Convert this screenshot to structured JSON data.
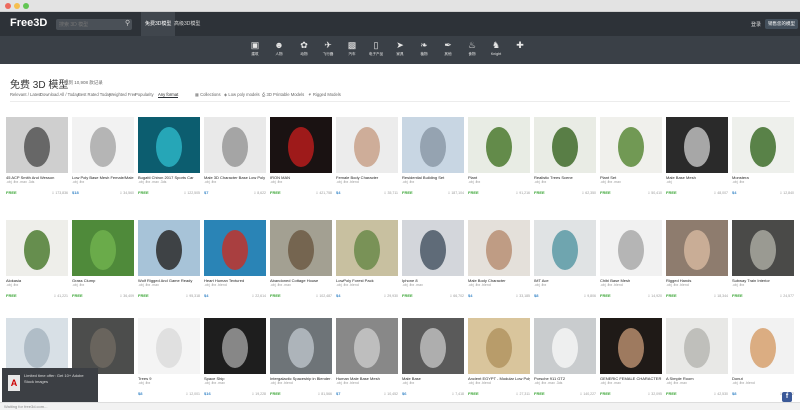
{
  "header": {
    "logo": "Free3D",
    "search_placeholder": "搜索 3D 模型",
    "tabs": [
      {
        "label": "免费3D模型"
      },
      {
        "label": "高级3D模型"
      }
    ],
    "links": [
      {
        "label": "登录"
      }
    ],
    "cta": "销售您的模型"
  },
  "categories": [
    {
      "label": "建筑",
      "icon": "building-icon"
    },
    {
      "label": "人物",
      "icon": "person-icon"
    },
    {
      "label": "动物",
      "icon": "paw-icon"
    },
    {
      "label": "飞行器",
      "icon": "plane-icon"
    },
    {
      "label": "汽车",
      "icon": "car-icon"
    },
    {
      "label": "电子产品",
      "icon": "phone-icon"
    },
    {
      "label": "家具",
      "icon": "sofa-icon"
    },
    {
      "label": "植物",
      "icon": "leaf-icon"
    },
    {
      "label": "其他",
      "icon": "feather-icon"
    },
    {
      "label": "食物",
      "icon": "food-icon"
    },
    {
      "label": "Knight",
      "icon": "knight-icon"
    },
    {
      "label": "",
      "icon": "plus-icon"
    }
  ],
  "page": {
    "title": "免费 3D 模型",
    "count": "找到 10,908 款记录"
  },
  "filters": [
    {
      "label": "Relevant / Latest",
      "active": false
    },
    {
      "label": "Download All / Today",
      "active": false
    },
    {
      "label": "Best Rated Today",
      "active": false
    },
    {
      "label": "Weighted Free",
      "active": false
    },
    {
      "label": "Popularity",
      "active": false
    },
    {
      "label": "Any format",
      "active": true
    }
  ],
  "filter_icons": [
    {
      "label": "Collections"
    },
    {
      "label": "Low poly models"
    },
    {
      "label": "3D Printable Models"
    },
    {
      "label": "Rigged Models"
    }
  ],
  "rows": [
    [
      {
        "title": "45 ACP Smith And Wesson",
        "formats": ".obj .fbx .max .3ds",
        "price": "FREE",
        "stats": "173,836",
        "thumb": "#cfcfcf",
        "fg": "#555"
      },
      {
        "title": "Low Poly Base Mesh Female/Male",
        "formats": ".obj .fbx",
        "price": "$18",
        "stats": "34,560",
        "thumb": "#f2f2f2",
        "fg": "#aaa"
      },
      {
        "title": "Bugatti Chiron 2017 Sports Car",
        "formats": ".obj .fbx .max .3ds",
        "price": "FREE",
        "stats": "122,505",
        "thumb": "#0c5d6f",
        "fg": "#2bb3c4"
      },
      {
        "title": "Male 3D Character Base Low Poly Model",
        "formats": ".obj .fbx",
        "price": "$7",
        "stats": "8,622",
        "thumb": "#e9e9e9",
        "fg": "#999"
      },
      {
        "title": "IRON MAN",
        "formats": ".obj .fbx",
        "price": "FREE",
        "stats": "421,758",
        "thumb": "#1a1212",
        "fg": "#b61c1c"
      },
      {
        "title": "Female Body Character",
        "formats": ".obj .fbx .blend",
        "price": "$4",
        "stats": "35,711",
        "thumb": "#ececec",
        "fg": "#c9a28b"
      },
      {
        "title": "Residential Building Set",
        "formats": ".obj .fbx",
        "price": "FREE",
        "stats": "187,104",
        "thumb": "#c8d6e3",
        "fg": "#8c9aa8"
      },
      {
        "title": "Plant",
        "formats": ".obj .fbx",
        "price": "FREE",
        "stats": "91,216",
        "thumb": "#e8ece4",
        "fg": "#4b7a2f"
      },
      {
        "title": "Realistic Trees Scene",
        "formats": ".obj .fbx",
        "price": "FREE",
        "stats": "62,350",
        "thumb": "#e9ece5",
        "fg": "#3f6b2a"
      },
      {
        "title": "Plant Set",
        "formats": ".obj .fbx .max",
        "price": "FREE",
        "stats": "50,410",
        "thumb": "#f0f0ec",
        "fg": "#5a8a3a"
      },
      {
        "title": "Male Base Mesh",
        "formats": ".obj",
        "price": "FREE",
        "stats": "48,007",
        "thumb": "#2a2a2a",
        "fg": "#bdbdbd"
      },
      {
        "title": "Monstera",
        "formats": ".obj .fbx",
        "price": "$4",
        "stats": "12,840",
        "thumb": "#eef0ec",
        "fg": "#3e6e2c"
      }
    ],
    [
      {
        "title": "Alokasia",
        "formats": ".obj .fbx",
        "price": "FREE",
        "stats": "41,221",
        "thumb": "#eeeeea",
        "fg": "#4d7c33"
      },
      {
        "title": "Grass Clump",
        "formats": ".obj .fbx",
        "price": "FREE",
        "stats": "36,409",
        "thumb": "#4f8a3a",
        "fg": "#6fb04e"
      },
      {
        "title": "Wolf Rigged And Game Ready",
        "formats": ".obj .fbx .max",
        "price": "FREE",
        "stats": "95,318",
        "thumb": "#a7c3d8",
        "fg": "#2b2b2b"
      },
      {
        "title": "Heart Human Textured",
        "formats": ".obj .fbx .blend",
        "price": "$4",
        "stats": "22,614",
        "thumb": "#2a84b6",
        "fg": "#c0322b"
      },
      {
        "title": "Abandoned Cottage House",
        "formats": ".obj .fbx .max",
        "price": "FREE",
        "stats": "102,487",
        "thumb": "#a3a092",
        "fg": "#6d5b44"
      },
      {
        "title": "LowPoly Forest Pack",
        "formats": ".obj .fbx .blend",
        "price": "$4",
        "stats": "29,930",
        "thumb": "#c8c0a0",
        "fg": "#6b8a4a"
      },
      {
        "title": "Iphone 8",
        "formats": ".obj .fbx .max",
        "price": "FREE",
        "stats": "66,702",
        "thumb": "#d3d6db",
        "fg": "#4a5866"
      },
      {
        "title": "Male Body Character",
        "formats": ".obj .fbx .blend",
        "price": "$4",
        "stats": "33,185",
        "thumb": "#e4e0da",
        "fg": "#b98f74"
      },
      {
        "title": "IMT Ace",
        "formats": ".obj .fbx",
        "price": "$8",
        "stats": "9,806",
        "thumb": "#e0e3e4",
        "fg": "#5b9aa6"
      },
      {
        "title": "Chibi Base Mesh",
        "formats": ".obj .fbx .blend",
        "price": "FREE",
        "stats": "14,920",
        "thumb": "#f1f1f1",
        "fg": "#aaaaaa"
      },
      {
        "title": "Rigged Hands",
        "formats": ".obj .fbx .blend",
        "price": "FREE",
        "stats": "18,344",
        "thumb": "#8e7c6e",
        "fg": "#d4b69e"
      },
      {
        "title": "Subway Train Interior",
        "formats": ".obj .fbx",
        "price": "FREE",
        "stats": "24,577",
        "thumb": "#4a4a48",
        "fg": "#a8a8a0"
      }
    ],
    [
      {
        "title": "",
        "formats": "",
        "price": "",
        "stats": "",
        "thumb": "#d8e0e6",
        "fg": "#a9b6c1"
      },
      {
        "title": "",
        "formats": "",
        "price": "",
        "stats": "",
        "thumb": "#4c4d4c",
        "fg": "#6f6860"
      },
      {
        "title": "Trees 9",
        "formats": ".obj .fbx",
        "price": "$8",
        "stats": "12,001",
        "thumb": "#f4f4f4",
        "fg": "#dcdcdc"
      },
      {
        "title": "Space Ship",
        "formats": ".obj .fbx .max",
        "price": "$16",
        "stats": "19,228",
        "thumb": "#1e1e1e",
        "fg": "#9a9a9a"
      },
      {
        "title": "Intergalactic Spaceship in Blender 2.8 Eevee",
        "formats": ".obj .fbx .blend",
        "price": "FREE",
        "stats": "81,566",
        "thumb": "#6e7478",
        "fg": "#b8c0c6"
      },
      {
        "title": "Human Male Base Mesh",
        "formats": ".obj .fbx .blend",
        "price": "$7",
        "stats": "10,452",
        "thumb": "#888888",
        "fg": "#c8c8c8"
      },
      {
        "title": "Male Base",
        "formats": ".obj .fbx",
        "price": "$6",
        "stats": "7,418",
        "thumb": "#5a5a5a",
        "fg": "#bdbdbd"
      },
      {
        "title": "Ancient EGYPT - Modular Low Poly Architecture Set For Games",
        "formats": ".obj .fbx .blend",
        "price": "FREE",
        "stats": "27,311",
        "thumb": "#d9c59c",
        "fg": "#b19461"
      },
      {
        "title": "Porsche 911 GT2",
        "formats": ".obj .fbx .max .3ds",
        "price": "FREE",
        "stats": "140,227",
        "thumb": "#c9ccce",
        "fg": "#f4f4f4"
      },
      {
        "title": "GENERIC FEMALE CHARACTER",
        "formats": ".obj .fbx .max",
        "price": "FREE",
        "stats": "32,095",
        "thumb": "#1f1a17",
        "fg": "#b58c6c"
      },
      {
        "title": "A Simple Room",
        "formats": ".obj .fbx .max",
        "price": "FREE",
        "stats": "42,530",
        "thumb": "#e8e8e6",
        "fg": "#b7b7b3"
      },
      {
        "title": "Donut",
        "formats": ".obj .fbx .blend",
        "price": "$8",
        "stats": "18,902",
        "thumb": "#f2f2f2",
        "fg": "#d7a16f"
      }
    ]
  ],
  "overlay": {
    "text": "Limited time offer: Get 10+ Adobe Stock images",
    "logo": "A"
  },
  "statusbar": "Waiting for free3d.com...",
  "colors": {
    "free": "#3aa535",
    "paid": "#3a87c8"
  }
}
